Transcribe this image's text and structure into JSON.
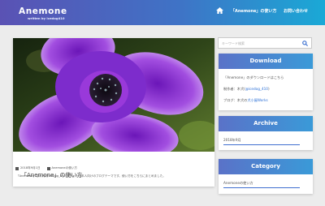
{
  "header": {
    "title": "Anemone",
    "subtitle": "written by icedog410",
    "nav": [
      {
        "label": "「Anemone」の使い方"
      },
      {
        "label": "お問い合わせ"
      }
    ]
  },
  "post": {
    "title": "「Anemone」の使い方",
    "date": "2018年9月1日",
    "category": "Anemoneの使い方",
    "excerpt": "「Anemone」は木犬(@icedog_410)が作った日本人向けのブログテーマです。使い方をこちらにまとめました。"
  },
  "search": {
    "placeholder": "キーワード検索"
  },
  "sidebar": {
    "download": {
      "title": "Download",
      "lines": [
        {
          "text": "「Anemone」のダウンロードはこちら"
        },
        {
          "prefix": "制作者：木犬(",
          "link": "@icedog_410",
          "suffix": ")"
        },
        {
          "prefix": "ブログ：木犬の",
          "link": "犬小屋Works",
          "suffix": ""
        }
      ]
    },
    "archive": {
      "title": "Archive",
      "item": "2018年9月"
    },
    "category": {
      "title": "Category",
      "item": "Anemoneの使い方"
    }
  },
  "colors": {
    "header_start": "#5a52b4",
    "header_end": "#1aa9d6",
    "link": "#2a6fd6",
    "widget_head": "#4a86d0"
  }
}
